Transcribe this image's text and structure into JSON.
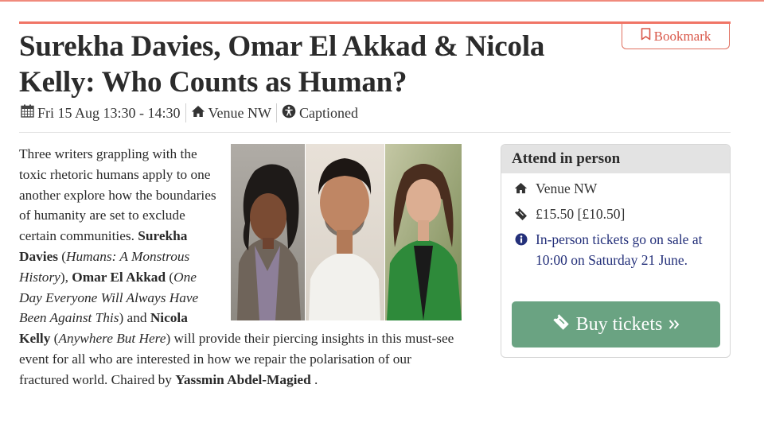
{
  "bookmark": {
    "label": "Bookmark",
    "icon": "bookmark-icon"
  },
  "event": {
    "title": "Surekha Davies, Omar El Akkad & Nicola Kelly: Who Counts as Human?",
    "date": "Fri 15 Aug 13:30 - 14:30",
    "venue": "Venue NW",
    "access": "Captioned"
  },
  "description": {
    "intro": "Three writers grappling with the toxic rhetoric humans apply to one another explore how the boundaries of humanity are set to exclude certain communities.",
    "speaker1": "Surekha Davies",
    "book1": "Humans: A Monstrous History",
    "speaker2": "Omar El Akkad",
    "book2": "One Day Everyone Will Always Have Been Against This",
    "and": "and",
    "speaker3": "Nicola Kelly",
    "book3": "Anywhere But Here",
    "rest": "will provide their piercing insights in this must-see event for all who are interested in how we repair the polarisation of our fractured world. Chaired by",
    "chair": "Yassmin Abdel-Magied",
    "end": "."
  },
  "attend": {
    "heading": "Attend in person",
    "venue": "Venue NW",
    "price": "£15.50 [£10.50]",
    "notice": "In-person tickets go on sale at 10:00 on Saturday 21 June.",
    "buy_label": "Buy tickets"
  },
  "colors": {
    "accent": "#f07566",
    "button": "#6aa382",
    "info": "#24307a"
  }
}
